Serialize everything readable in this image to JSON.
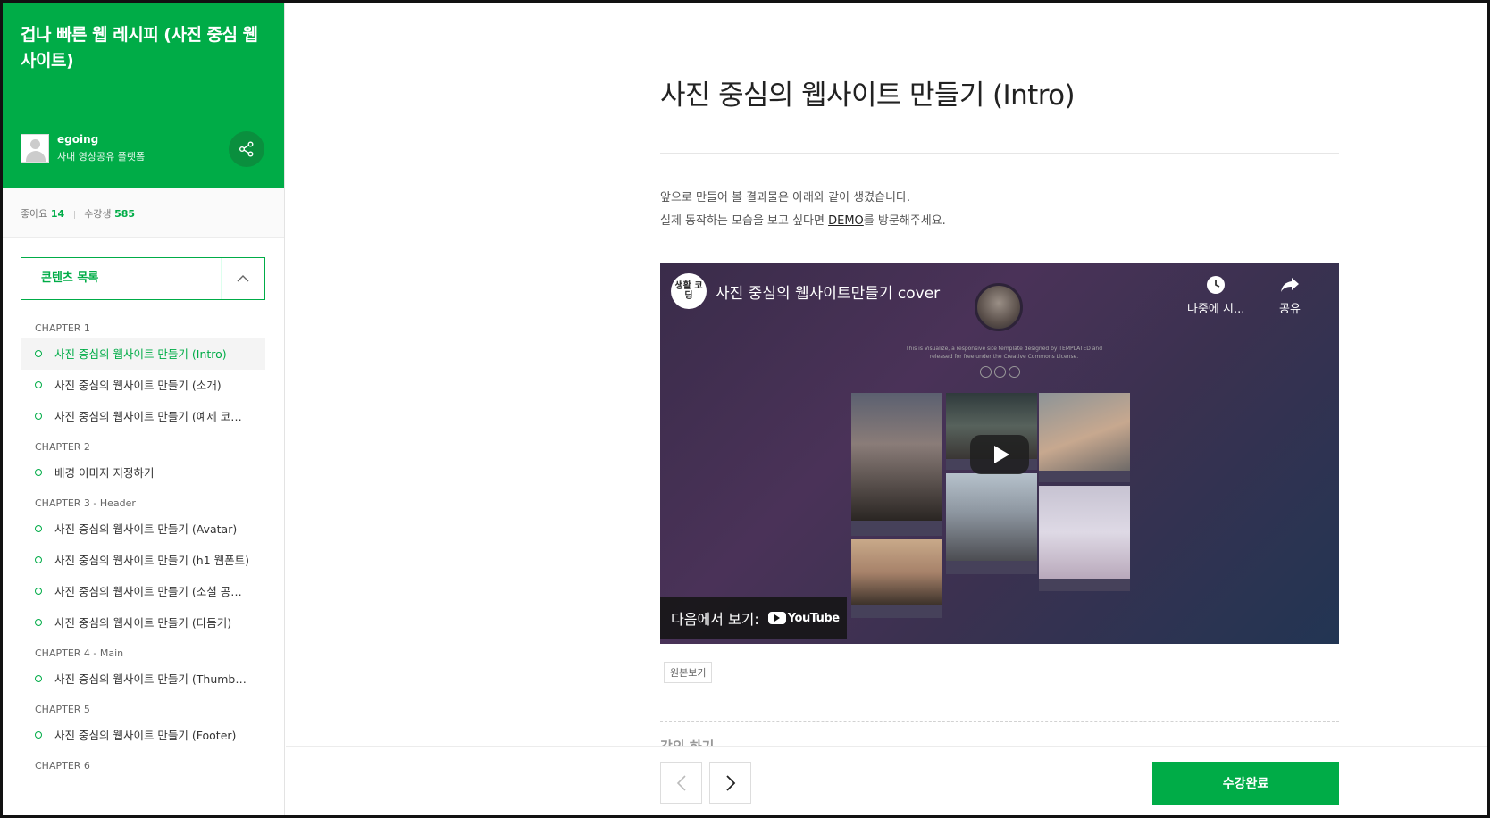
{
  "sidebar": {
    "course_title": "겁나 빠른 웹 레시피 (사진 중심 웹사이트)",
    "author_name": "egoing",
    "author_org": "사내 영상공유 플랫폼",
    "likes_label": "좋아요",
    "likes_count": "14",
    "students_label": "수강생",
    "students_count": "585",
    "toc_label": "콘텐츠 목록",
    "chapters": [
      {
        "title": "CHAPTER 1",
        "lessons": [
          "사진 중심의 웹사이트 만들기 (Intro)",
          "사진 중심의 웹사이트 만들기 (소개)",
          "사진 중심의 웹사이트 만들기 (예제 코…"
        ]
      },
      {
        "title": "CHAPTER 2",
        "lessons": [
          "배경 이미지 지정하기"
        ]
      },
      {
        "title": "CHAPTER 3 - Header",
        "lessons": [
          "사진 중심의 웹사이트 만들기 (Avatar)",
          "사진 중심의 웹사이트 만들기 (h1 웹폰트)",
          "사진 중심의 웹사이트 만들기 (소셜 공…",
          "사진 중심의 웹사이트 만들기 (다듬기)"
        ]
      },
      {
        "title": "CHAPTER 4 - Main",
        "lessons": [
          "사진 중심의 웹사이트 만들기 (Thumb…"
        ]
      },
      {
        "title": "CHAPTER 5",
        "lessons": [
          "사진 중심의 웹사이트 만들기 (Footer)"
        ]
      },
      {
        "title": "CHAPTER 6",
        "lessons": []
      }
    ]
  },
  "main": {
    "page_title": "사진 중심의 웹사이트 만들기 (Intro)",
    "desc_line1": "앞으로 만들어 볼 결과물은 아래와 같이 생겼습니다.",
    "desc_line2_pre": "실제 동작하는 모습을 보고 싶다면 ",
    "desc_link": "DEMO",
    "desc_line2_post": "를 방문해주세요.",
    "video": {
      "channel_logo": "생활 코딩",
      "title": "사진 중심의 웹사이트만들기 cover",
      "watch_later": "나중에 시...",
      "share": "공유",
      "watch_on": "다음에서 보기:",
      "youtube": "YouTube",
      "thumb_caption": "This is Visualize, a responsive site template designed by TEMPLATED and released for free under the Creative Commons License."
    },
    "source_tag": "원본보기",
    "next_section_hint": "강의 하기",
    "complete_label": "수강완료"
  },
  "colors": {
    "accent": "#00ac47",
    "share_btn": "#0a8f3e"
  }
}
